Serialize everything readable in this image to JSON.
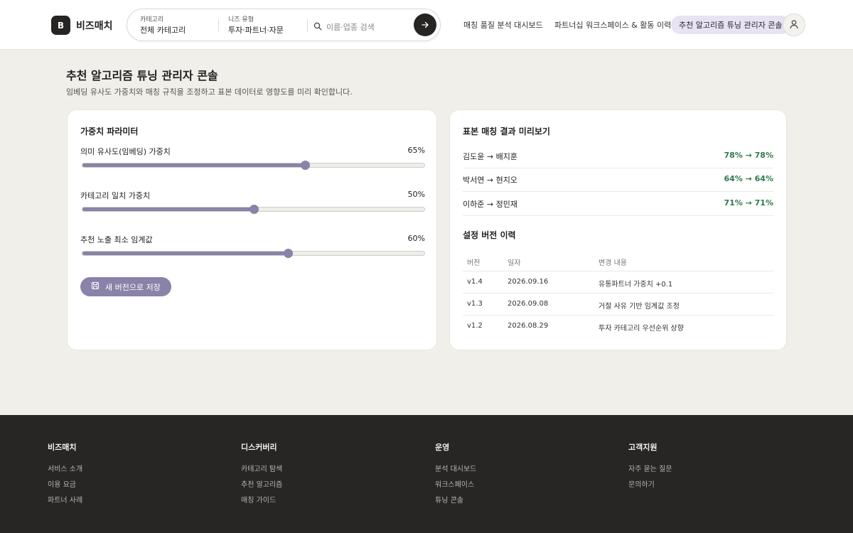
{
  "brand": {
    "mark": "B",
    "name": "비즈매치"
  },
  "search": {
    "category_label": "카테고리",
    "category_value": "전체 카테고리",
    "need_label": "니즈 유형",
    "need_value": "투자·파트너·자문",
    "placeholder": "이름·업종 검색"
  },
  "nav": {
    "items": [
      "매칭 품질 분석 대시보드",
      "파트너십 워크스페이스 & 활동 이력",
      "추천 알고리즘 튜닝 관리자 콘솔"
    ],
    "active_index": 2,
    "active_color": "#e7e3f2"
  },
  "page": {
    "title": "추천 알고리즘 튜닝 관리자 콘솔",
    "description": "임베딩 유사도 가중치와 매칭 규칙을 조정하고 표본 데이터로 영향도를 미리 확인합니다."
  },
  "params": {
    "title": "가중치 파라미터",
    "items": [
      {
        "name": "의미 유사도(임베딩) 가중치",
        "value_label": "65%",
        "value": 0.65
      },
      {
        "name": "카테고리 일치 가중치",
        "value_label": "50%",
        "value": 0.5
      },
      {
        "name": "추천 노출 최소 임계값",
        "value_label": "60%",
        "value": 0.6
      }
    ],
    "save_label": "새 버전으로 저장",
    "accent_color": "#8a82a8"
  },
  "preview": {
    "title": "표본 매칭 결과 미리보기",
    "rows": [
      {
        "pair": "김도윤 → 배지훈",
        "score": "78% → 78%"
      },
      {
        "pair": "박서연 → 현지오",
        "score": "64% → 64%"
      },
      {
        "pair": "이하준 → 정민재",
        "score": "71% → 71%"
      }
    ],
    "score_color": "#2f7a4a"
  },
  "versions": {
    "title": "설정 버전 이력",
    "headers": [
      "버전",
      "일자",
      "변경 내용"
    ],
    "rows": [
      [
        "v1.4",
        "2026.09.16",
        "유통파트너 가중치 +0.1"
      ],
      [
        "v1.3",
        "2026.09.08",
        "거절 사유 기반 임계값 조정"
      ],
      [
        "v1.2",
        "2026.08.29",
        "투자 카테고리 우선순위 상향"
      ]
    ]
  },
  "footer": {
    "columns": [
      {
        "heading": "비즈매치",
        "links": [
          "서비스 소개",
          "이용 요금",
          "파트너 사례"
        ]
      },
      {
        "heading": "디스커버리",
        "links": [
          "카테고리 탐색",
          "추천 알고리즘",
          "매칭 가이드"
        ]
      },
      {
        "heading": "운영",
        "links": [
          "분석 대시보드",
          "워크스페이스",
          "튜닝 콘솔"
        ]
      },
      {
        "heading": "고객지원",
        "links": [
          "자주 묻는 질문",
          "문의하기"
        ]
      }
    ]
  }
}
